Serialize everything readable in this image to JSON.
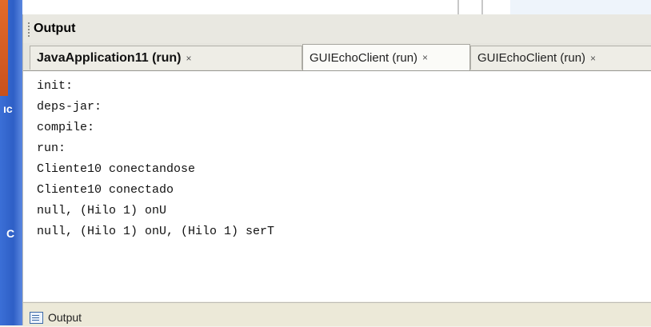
{
  "output": {
    "title": "Output",
    "tabs": [
      {
        "label": "JavaApplication11 (run)",
        "close": "×"
      },
      {
        "label": "GUIEchoClient (run)",
        "close": "×"
      },
      {
        "label": "GUIEchoClient (run)",
        "close": "×"
      }
    ],
    "console_lines": [
      "init:",
      "deps-jar:",
      "compile:",
      "run:",
      "Cliente10 conectandose",
      "Cliente10 conectado",
      "null, (Hilo 1) onU",
      "null, (Hilo 1) onU, (Hilo 1) serT"
    ]
  },
  "left_fragments": {
    "top": "ıc",
    "bottom": "C"
  },
  "bottom": {
    "tab_label": "Output"
  }
}
